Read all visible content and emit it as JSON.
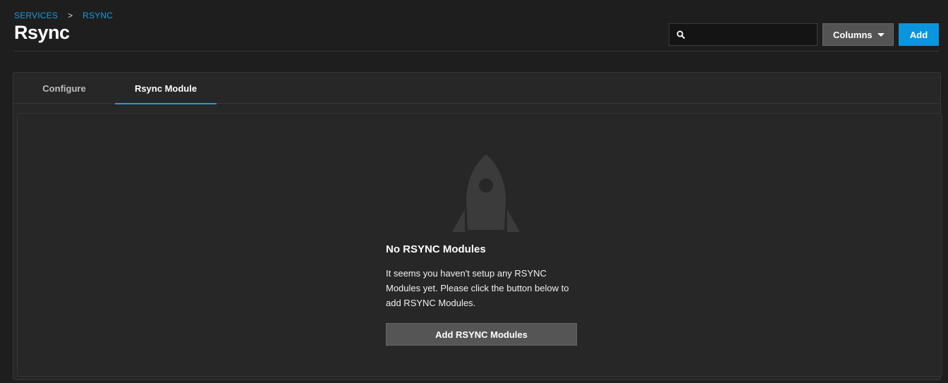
{
  "breadcrumb": {
    "items": [
      "SERVICES",
      "RSYNC"
    ],
    "separator": ">"
  },
  "page": {
    "title": "Rsync"
  },
  "toolbar": {
    "search": {
      "value": "",
      "placeholder": "",
      "icon": "search-icon"
    },
    "columns_label": "Columns",
    "add_label": "Add"
  },
  "tabs": [
    {
      "label": "Configure",
      "active": false
    },
    {
      "label": "Rsync Module",
      "active": true
    }
  ],
  "empty_state": {
    "icon": "rocket-icon",
    "title": "No RSYNC Modules",
    "message": "It seems you haven't setup any RSYNC Modules yet. Please click the button below to add RSYNC Modules.",
    "action_label": "Add RSYNC Modules"
  },
  "colors": {
    "background": "#1e1e1e",
    "card": "#272727",
    "accent": "#0a95de",
    "link": "#1a9ce0",
    "icon_muted": "#3b3b3b"
  }
}
